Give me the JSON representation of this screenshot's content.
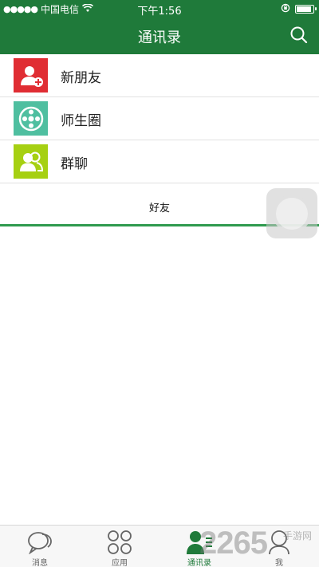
{
  "status_bar": {
    "signal": "●●●●●",
    "carrier": "中国电信",
    "time": "下午1:56"
  },
  "header": {
    "title": "通讯录",
    "search_icon": "search-icon"
  },
  "list": [
    {
      "label": "新朋友",
      "icon": "new-friend-icon",
      "color": "#e02d33"
    },
    {
      "label": "师生圈",
      "icon": "circle-icon",
      "color": "#4fbfa0"
    },
    {
      "label": "群聊",
      "icon": "group-chat-icon",
      "color": "#a6d012"
    }
  ],
  "tabs": {
    "friends": "好友"
  },
  "bottom_nav": [
    {
      "label": "消息",
      "icon": "message-icon",
      "active": false
    },
    {
      "label": "应用",
      "icon": "apps-icon",
      "active": false
    },
    {
      "label": "通讯录",
      "icon": "contacts-icon",
      "active": true
    },
    {
      "label": "我",
      "icon": "profile-icon",
      "active": false
    }
  ],
  "watermark": {
    "number": "2265",
    "text": "手游网"
  },
  "colors": {
    "header": "#1f7a3a",
    "accent": "#2f9a4e"
  }
}
